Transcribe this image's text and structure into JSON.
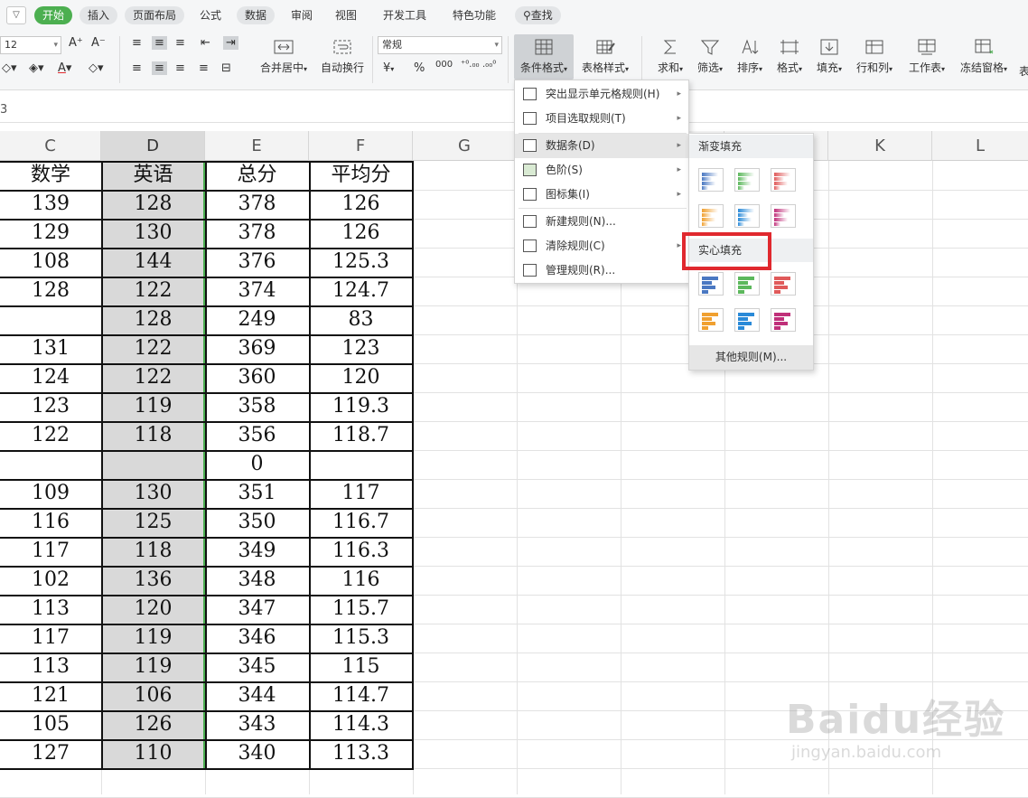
{
  "tabs": [
    "开始",
    "插入",
    "页面布局",
    "公式",
    "数据",
    "审阅",
    "视图",
    "开发工具",
    "特色功能"
  ],
  "search_label": "查找",
  "font_size": "12",
  "number_format": "常规",
  "cell_ref": "3",
  "ribbon": {
    "merge_center": "合并居中",
    "wrap_text": "自动换行",
    "cond_format": "条件格式",
    "table_style": "表格样式",
    "sum": "求和",
    "filter": "筛选",
    "sort": "排序",
    "format": "格式",
    "fill": "填充",
    "row_col": "行和列",
    "worksheet": "工作表",
    "freeze": "冻结窗格",
    "yen": "¥",
    "percent": "%",
    "thousands": "000"
  },
  "columns": [
    "C",
    "D",
    "E",
    "F",
    "G",
    "",
    "K",
    "L"
  ],
  "headers": {
    "c": "数学",
    "d": "英语",
    "e": "总分",
    "f": "平均分"
  },
  "rows": [
    {
      "c": "139",
      "d": "128",
      "e": "378",
      "f": "126"
    },
    {
      "c": "129",
      "d": "130",
      "e": "378",
      "f": "126"
    },
    {
      "c": "108",
      "d": "144",
      "e": "376",
      "f": "125.3"
    },
    {
      "c": "128",
      "d": "122",
      "e": "374",
      "f": "124.7"
    },
    {
      "c": "",
      "d": "128",
      "e": "249",
      "f": "83"
    },
    {
      "c": "131",
      "d": "122",
      "e": "369",
      "f": "123"
    },
    {
      "c": "124",
      "d": "122",
      "e": "360",
      "f": "120"
    },
    {
      "c": "123",
      "d": "119",
      "e": "358",
      "f": "119.3"
    },
    {
      "c": "122",
      "d": "118",
      "e": "356",
      "f": "118.7"
    },
    {
      "c": "",
      "d": "",
      "e": "0",
      "f": ""
    },
    {
      "c": "109",
      "d": "130",
      "e": "351",
      "f": "117"
    },
    {
      "c": "116",
      "d": "125",
      "e": "350",
      "f": "116.7"
    },
    {
      "c": "117",
      "d": "118",
      "e": "349",
      "f": "116.3"
    },
    {
      "c": "102",
      "d": "136",
      "e": "348",
      "f": "116"
    },
    {
      "c": "113",
      "d": "120",
      "e": "347",
      "f": "115.7"
    },
    {
      "c": "117",
      "d": "119",
      "e": "346",
      "f": "115.3"
    },
    {
      "c": "113",
      "d": "119",
      "e": "345",
      "f": "115"
    },
    {
      "c": "121",
      "d": "106",
      "e": "344",
      "f": "114.7"
    },
    {
      "c": "105",
      "d": "126",
      "e": "343",
      "f": "114.3"
    },
    {
      "c": "127",
      "d": "110",
      "e": "340",
      "f": "113.3"
    }
  ],
  "menu": [
    {
      "label": "突出显示单元格规则(H)",
      "arrow": "▸"
    },
    {
      "label": "项目选取规则(T)",
      "arrow": "▸"
    },
    {
      "label": "数据条(D)",
      "arrow": "▸"
    },
    {
      "label": "色阶(S)",
      "arrow": "▸"
    },
    {
      "label": "图标集(I)",
      "arrow": "▸"
    },
    {
      "label": "新建规则(N)...",
      "arrow": ""
    },
    {
      "label": "清除规则(C)",
      "arrow": "▸"
    },
    {
      "label": "管理规则(R)...",
      "arrow": ""
    }
  ],
  "submenu": {
    "gradient_title": "渐变填充",
    "solid_title": "实心填充",
    "more_rules": "其他规则(M)...",
    "colors": [
      "#4a78c2",
      "#5cb85c",
      "#e05a5a",
      "#f0a030",
      "#2a8ad8",
      "#c0307a"
    ]
  },
  "watermark": "Baidu经验",
  "watermark_url": "jingyan.baidu.com"
}
